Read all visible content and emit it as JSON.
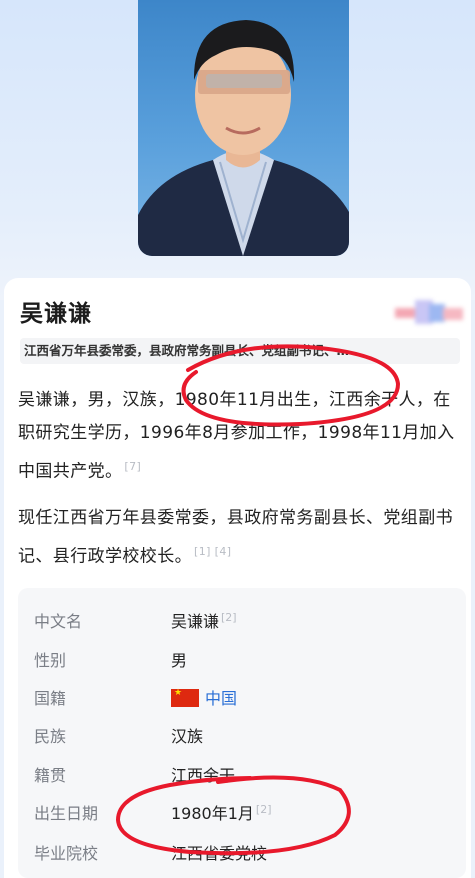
{
  "profile": {
    "name": "吴谦谦",
    "tagline": "江西省万年县委常委，县政府常务副县长、党组副书记、…"
  },
  "intro": {
    "para1": "吴谦谦，男，汉族，1980年11月出生，江西余干人，在职研究生学历，1996年8月参加工作，1998年11月加入中国共产党。",
    "para1_cite": "[7]",
    "para2": "现任江西省万年县委常委，县政府常务副县长、党组副书记、县行政学校校长。",
    "para2_cite": "[1] [4]"
  },
  "info": [
    {
      "key": "中文名",
      "value": "吴谦谦",
      "cite": "[2]"
    },
    {
      "key": "性别",
      "value": "男",
      "cite": ""
    },
    {
      "key": "国籍",
      "value": "中国",
      "cite": ""
    },
    {
      "key": "民族",
      "value": "汉族",
      "cite": ""
    },
    {
      "key": "籍贯",
      "value": "江西余干",
      "cite": ""
    },
    {
      "key": "出生日期",
      "value": "1980年1月",
      "cite": "[2]"
    },
    {
      "key": "毕业院校",
      "value": "江西省委党校",
      "cite": ""
    }
  ],
  "colors": {
    "accent_link": "#2a6fd6",
    "annotation_red": "#e8192c",
    "flag_red": "#de2910"
  },
  "icons": [
    "china-flag-icon"
  ]
}
